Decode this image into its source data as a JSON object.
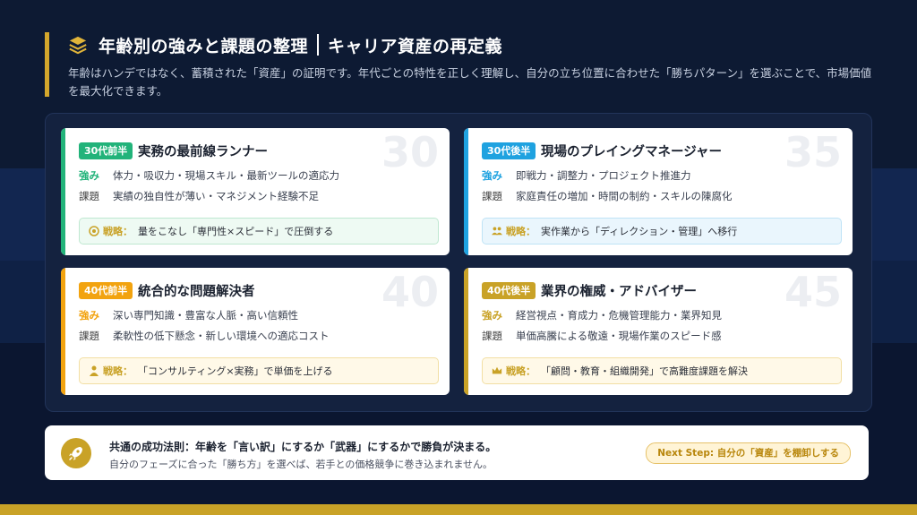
{
  "colors": {
    "gold": "#c9a227",
    "green": "#22b37a",
    "blue": "#1fa2e0",
    "orange": "#f2a30f",
    "bg": "#0d1a33"
  },
  "header": {
    "title": "年齢別の強みと課題の整理",
    "title2": "キャリア資産の再定義",
    "subtitle": "年齢はハンデではなく、蓄積された「資産」の証明です。年代ごとの特性を正しく理解し、自分の立ち位置に合わせた「勝ちパターン」を選ぶことで、市場価値を最大化できます。"
  },
  "cards": [
    {
      "badge": "30代前半",
      "title": "実務の最前線ランナー",
      "number": "30",
      "strength_label": "強み",
      "strength": "体力・吸収力・現場スキル・最新ツールの適応力",
      "issue_label": "課題",
      "issue": "実績の独自性が薄い・マネジメント経験不足",
      "strategy_label": "戦略：",
      "strategy": "量をこなし「専門性×スピード」で圧倒する"
    },
    {
      "badge": "30代後半",
      "title": "現場のプレイングマネージャー",
      "number": "35",
      "strength_label": "強み",
      "strength": "即戦力・調整力・プロジェクト推進力",
      "issue_label": "課題",
      "issue": "家庭責任の増加・時間の制約・スキルの陳腐化",
      "strategy_label": "戦略：",
      "strategy": "実作業から「ディレクション・管理」へ移行"
    },
    {
      "badge": "40代前半",
      "title": "統合的な問題解決者",
      "number": "40",
      "strength_label": "強み",
      "strength": "深い専門知識・豊富な人脈・高い信頼性",
      "issue_label": "課題",
      "issue": "柔軟性の低下懸念・新しい環境への適応コスト",
      "strategy_label": "戦略：",
      "strategy": "「コンサルティング×実務」で単価を上げる"
    },
    {
      "badge": "40代後半",
      "title": "業界の権威・アドバイザー",
      "number": "45",
      "strength_label": "強み",
      "strength": "経営視点・育成力・危機管理能力・業界知見",
      "issue_label": "課題",
      "issue": "単価高騰による敬遠・現場作業のスピード感",
      "strategy_label": "戦略：",
      "strategy": "「顧問・教育・組織開発」で高難度課題を解決"
    }
  ],
  "footer": {
    "line1": "共通の成功法則：年齢を「言い訳」にするか「武器」にするかで勝負が決まる。",
    "line2": "自分のフェーズに合った「勝ち方」を選べば、若手との価格競争に巻き込まれません。",
    "next_step": "Next Step: 自分の「資産」を棚卸しする"
  }
}
